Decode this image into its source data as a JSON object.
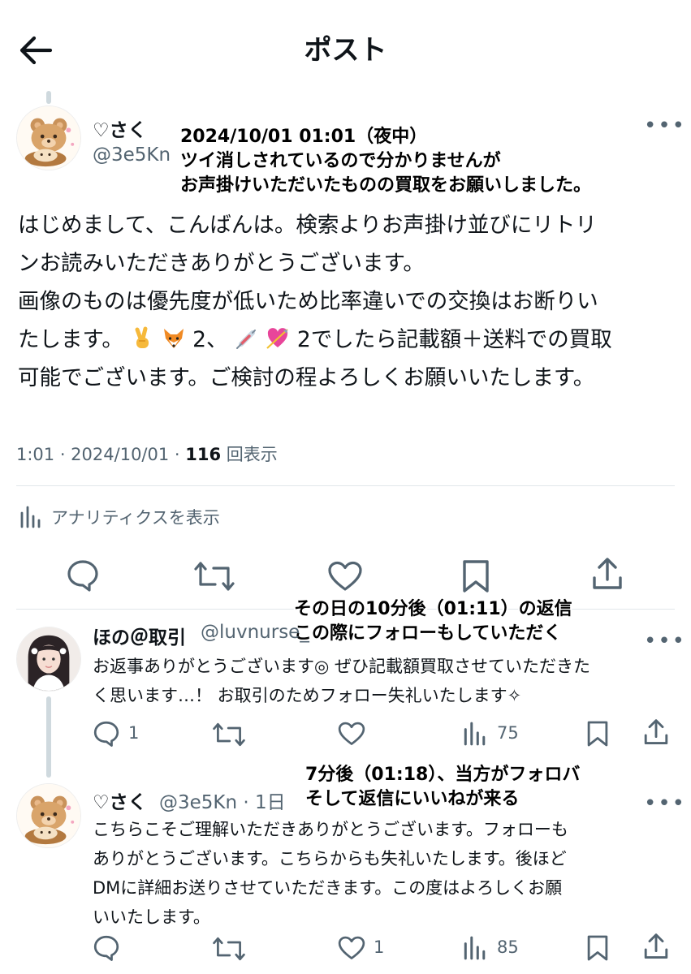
{
  "header": {
    "title": "ポスト"
  },
  "post": {
    "name": "♡さく",
    "handle": "@3e5Kn",
    "lines": [
      "はじめまして、こんばんは。検索よりお声掛け並びにリトリ",
      "ンお読みいただきありがとうございます。",
      "画像のものは優先度が低いため比率違いでの交換はお断りい"
    ],
    "line4_a": "たします。",
    "line4_b": "2、",
    "line4_c": "2でしたら記載額＋送料での買取",
    "line5": "可能でございます。ご検討の程よろしくお願いいたします。",
    "meta_time": "1:01 · 2024/10/01 · ",
    "meta_views": "116",
    "meta_views_label": " 回表示",
    "analytics_label": "アナリティクスを表示"
  },
  "notes": {
    "n1_line1": "2024/10/01 01:01（夜中）",
    "n1_line2": "ツイ消しされているので分かりませんが",
    "n1_line3": "お声掛けいただいたものの買取をお願いしました。",
    "n2_line1": "その日の10分後（01:11）の返信",
    "n2_line2": "この際にフォローもしていただく",
    "n3_line1": "7分後（01:18）、当方がフォロバ",
    "n3_line2": "そして返信にいいねが来る"
  },
  "reply1": {
    "name": "ほの＠取引",
    "handle": "@luvnurse_",
    "lines": [
      "お返事ありがとうございます◎ ぜひ記載額買取させていただきた",
      "く思います…！ お取引のためフォロー失礼いたします✧"
    ],
    "reply_count": "1",
    "views": "75"
  },
  "reply2": {
    "name": "♡さく",
    "handle": "@3e5Kn · 1日",
    "lines": [
      "こちらこそご理解いただきありがとうございます。フォローも",
      "ありがとうございます。こちらからも失礼いたします。後ほど",
      "DMに詳細お送りさせていただきます。この度はよろしくお願",
      "いいたします。"
    ],
    "like_count": "1",
    "views": "85"
  },
  "icons": {
    "back": "arrow-left-icon",
    "more": "more-dots-icon",
    "reply": "reply-bubble-icon",
    "retweet": "retweet-icon",
    "like": "heart-icon",
    "bookmark": "bookmark-icon",
    "share": "share-icon",
    "views": "bar-chart-icon",
    "emoji_victory": "victory-hand-emoji",
    "emoji_fox": "fox-emoji",
    "emoji_syringe": "syringe-emoji",
    "emoji_heart_arrow": "heart-with-arrow-emoji"
  },
  "colors": {
    "text": "#0f1419",
    "secondary": "#536471",
    "divider": "#e1e6ea"
  }
}
